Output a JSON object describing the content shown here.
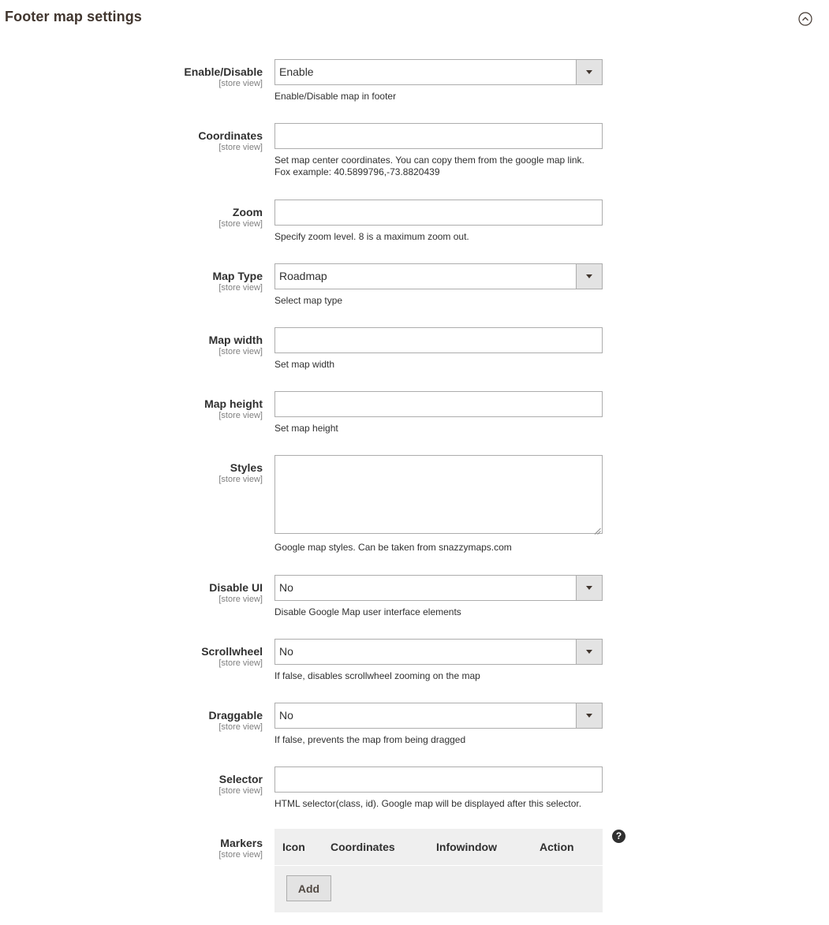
{
  "section": {
    "title": "Footer map settings"
  },
  "scope_label": "[store view]",
  "fields": {
    "enable": {
      "label": "Enable/Disable",
      "value": "Enable",
      "note": "Enable/Disable map in footer"
    },
    "coordinates": {
      "label": "Coordinates",
      "value": "",
      "note_line1": "Set map center coordinates. You can copy them from the google map link.",
      "note_line2": "Fox example: 40.5899796,-73.8820439"
    },
    "zoom": {
      "label": "Zoom",
      "value": "",
      "note": "Specify zoom level. 8 is a maximum zoom out."
    },
    "map_type": {
      "label": "Map Type",
      "value": "Roadmap",
      "note": "Select map type"
    },
    "map_width": {
      "label": "Map width",
      "value": "",
      "note": "Set map width"
    },
    "map_height": {
      "label": "Map height",
      "value": "",
      "note": "Set map height"
    },
    "styles": {
      "label": "Styles",
      "value": "",
      "note": "Google map styles. Can be taken from snazzymaps.com"
    },
    "disable_ui": {
      "label": "Disable UI",
      "value": "No",
      "note": "Disable Google Map user interface elements"
    },
    "scrollwheel": {
      "label": "Scrollwheel",
      "value": "No",
      "note": "If false, disables scrollwheel zooming on the map"
    },
    "draggable": {
      "label": "Draggable",
      "value": "No",
      "note": "If false, prevents the map from being dragged"
    },
    "selector": {
      "label": "Selector",
      "value": "",
      "note": "HTML selector(class, id). Google map will be displayed after this selector."
    },
    "markers": {
      "label": "Markers",
      "columns": [
        "Icon",
        "Coordinates",
        "Infowindow",
        "Action"
      ],
      "add_label": "Add",
      "help_glyph": "?"
    }
  }
}
